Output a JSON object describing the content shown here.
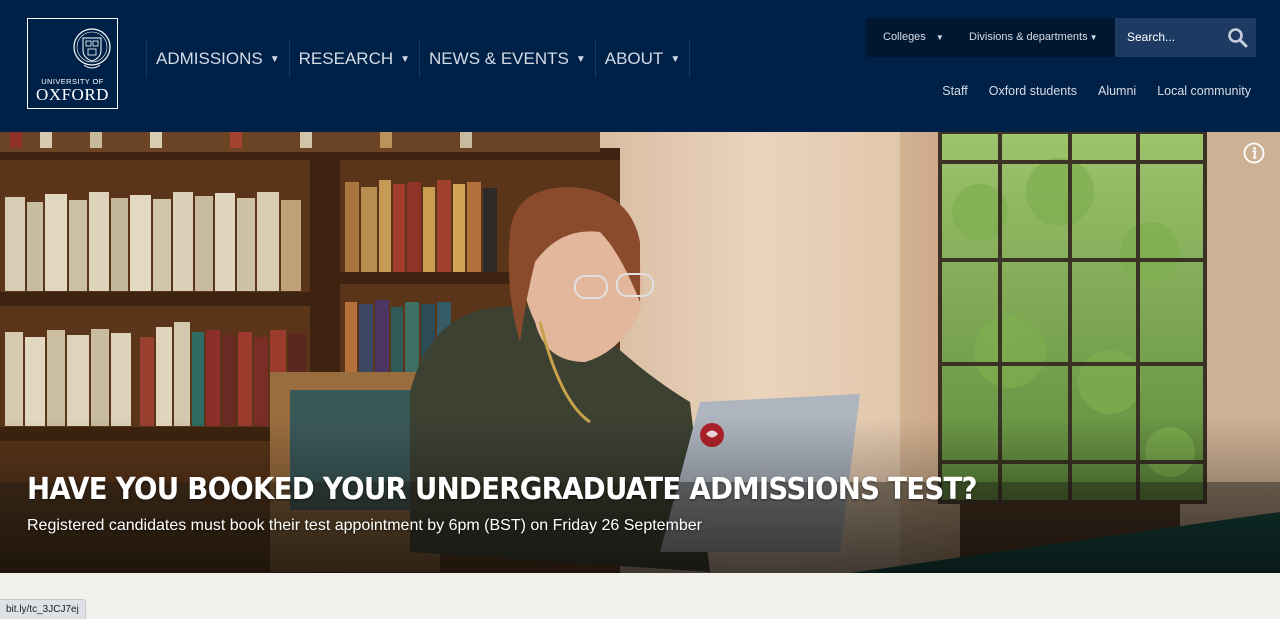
{
  "brand": {
    "line1": "UNIVERSITY OF",
    "line2": "OXFORD",
    "crest_icon": "oxford-crest-icon"
  },
  "main_nav": [
    {
      "label": "ADMISSIONS"
    },
    {
      "label": "RESEARCH"
    },
    {
      "label": "NEWS & EVENTS"
    },
    {
      "label": "ABOUT"
    }
  ],
  "top_bar": {
    "colleges": "Colleges",
    "divisions": "Divisions & departments",
    "search_placeholder": "Search..."
  },
  "secondary_nav": [
    "Staff",
    "Oxford students",
    "Alumni",
    "Local community"
  ],
  "hero": {
    "title": "HAVE YOU BOOKED YOUR UNDERGRADUATE ADMISSIONS TEST?",
    "subtitle": "Registered candidates must book their test appointment by 6pm (BST) on Friday 26 September"
  },
  "status_bar": {
    "url": "bit.ly/tc_3JCJ7ej"
  },
  "colors": {
    "oxford_blue": "#002147",
    "dropdown_bg": "#001731",
    "search_bg": "#1c3a62",
    "page_bg": "#f2f0eb"
  },
  "icons": [
    "oxford-crest-icon",
    "chevron-down-icon",
    "search-icon",
    "info-icon"
  ]
}
